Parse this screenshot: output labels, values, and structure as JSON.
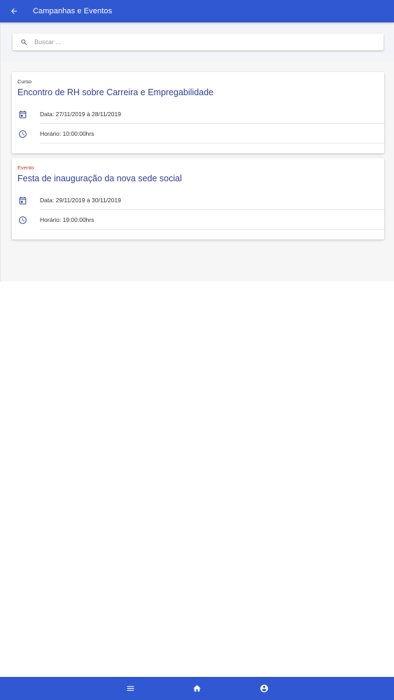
{
  "header": {
    "title": "Campanhas e Eventos",
    "back_icon": "arrow-left-icon"
  },
  "search": {
    "placeholder": "Buscar ...",
    "value": "",
    "icon": "search-icon"
  },
  "cards": [
    {
      "type": "Curso",
      "type_color": "#333333",
      "title": "Encontro de RH sobre Carreira e Empregabilidade",
      "date": "Data: 27/11/2019 à 28/11/2019",
      "time": "Horário: 10:00:00hrs"
    },
    {
      "type": "Evento",
      "type_color": "#c0392b",
      "title": "Festa de inauguração da nova sede social",
      "date": "Data: 29/11/2019 à 30/11/2019",
      "time": "Horário: 19:00:00hrs"
    }
  ],
  "bottom_nav": {
    "items": [
      "menu-icon",
      "home-icon",
      "account-circle-icon"
    ]
  },
  "colors": {
    "primary": "#3058d3",
    "title": "#2d3f95",
    "event_label": "#c0392b"
  }
}
